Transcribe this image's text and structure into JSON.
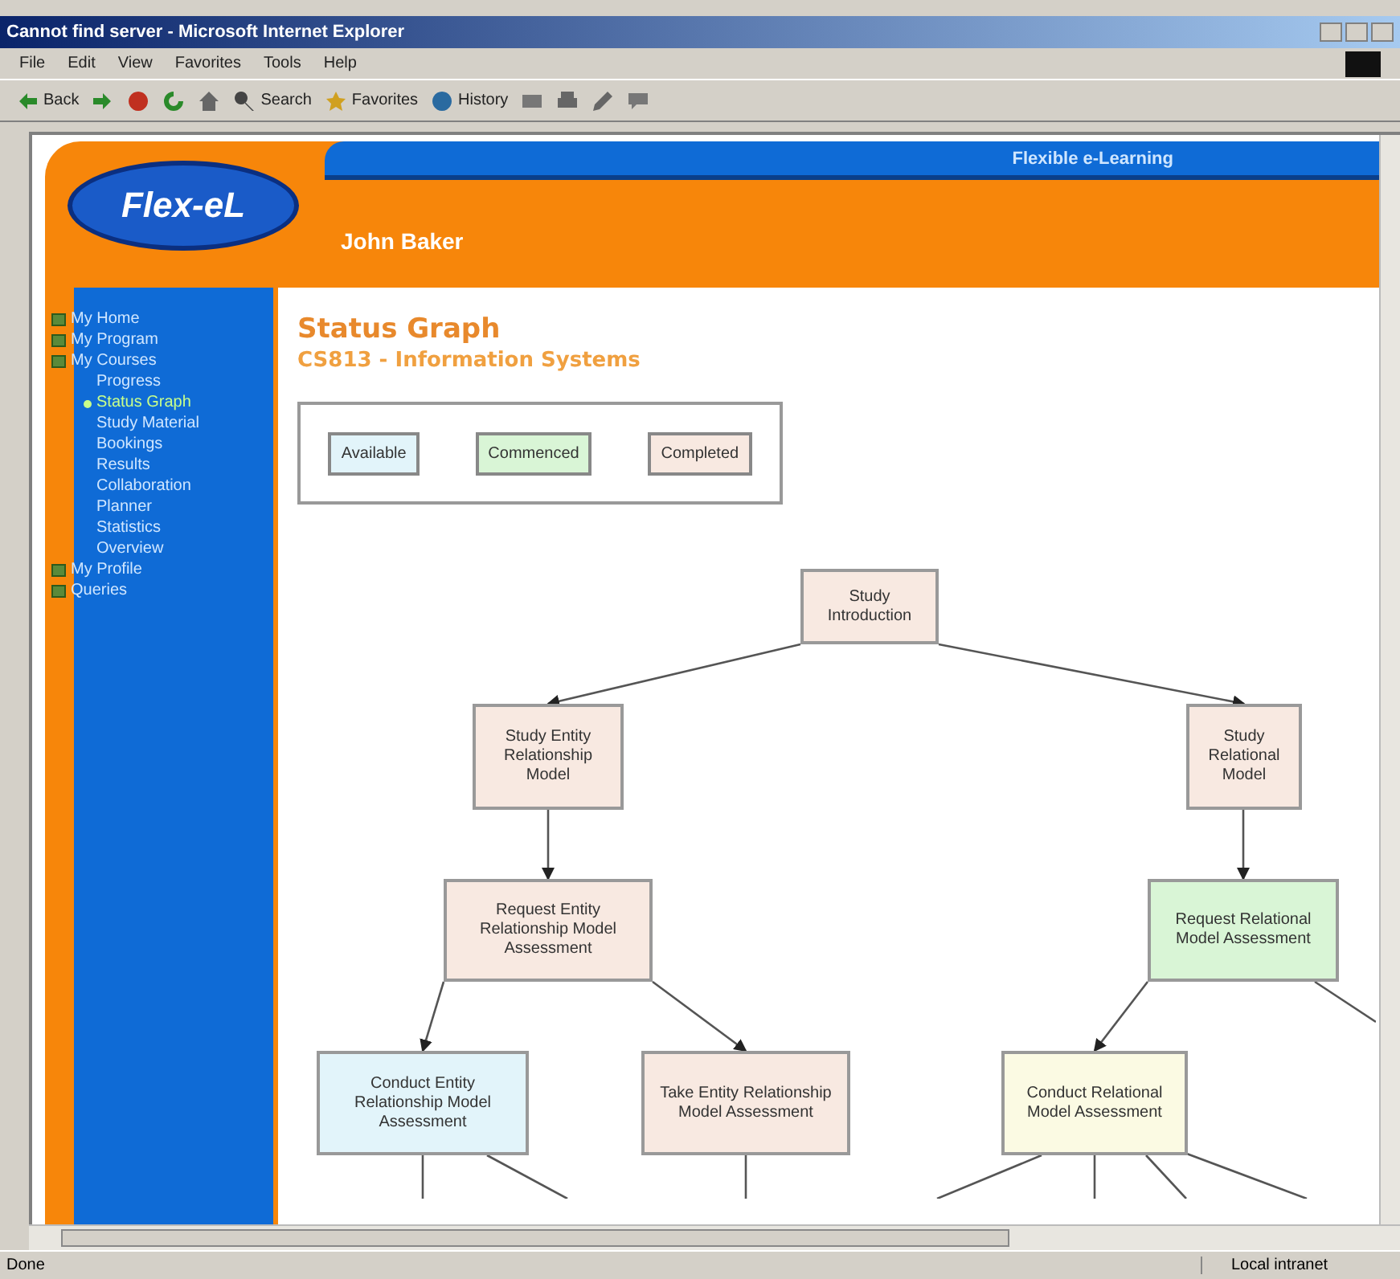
{
  "window": {
    "title": "Cannot find server - Microsoft Internet Explorer"
  },
  "menu": [
    "File",
    "Edit",
    "View",
    "Favorites",
    "Tools",
    "Help"
  ],
  "toolbar": [
    {
      "kind": "back",
      "label": "Back"
    },
    {
      "kind": "forward"
    },
    {
      "kind": "stop"
    },
    {
      "kind": "refresh"
    },
    {
      "kind": "home"
    },
    {
      "kind": "search",
      "label": "Search"
    },
    {
      "kind": "favorites",
      "label": "Favorites"
    },
    {
      "kind": "history",
      "label": "History"
    },
    {
      "kind": "mail"
    },
    {
      "kind": "print"
    },
    {
      "kind": "edit"
    },
    {
      "kind": "discuss"
    }
  ],
  "header": {
    "logo": "Flex-eL",
    "tagline": "Flexible e-Learning",
    "user": "John Baker"
  },
  "sidebar": {
    "items": [
      {
        "label": "My Home",
        "selected": false
      },
      {
        "label": "My Program",
        "selected": false
      },
      {
        "label": "My Courses",
        "selected": false,
        "children": [
          {
            "label": "Progress",
            "selected": false
          },
          {
            "label": "Status Graph",
            "selected": true
          },
          {
            "label": "Study Material",
            "selected": false
          },
          {
            "label": "Bookings",
            "selected": false
          },
          {
            "label": "Results",
            "selected": false
          },
          {
            "label": "Collaboration",
            "selected": false
          },
          {
            "label": "Planner",
            "selected": false
          },
          {
            "label": "Statistics",
            "selected": false
          },
          {
            "label": "Overview",
            "selected": false
          }
        ]
      },
      {
        "label": "My Profile",
        "selected": false
      },
      {
        "label": "Queries",
        "selected": false
      }
    ]
  },
  "main": {
    "title": "Status Graph",
    "subtitle": "CS813 - Information Systems",
    "legend": [
      {
        "label": "Available",
        "color": "#e2f4fa"
      },
      {
        "label": "Commenced",
        "color": "#d9f5d6"
      },
      {
        "label": "Completed",
        "color": "#f8e9e1"
      }
    ],
    "graph": {
      "nodes": [
        {
          "label": "Study Introduction",
          "color": "#f8e9e1",
          "children": [
            {
              "label": "Study Entity Relationship Model",
              "color": "#f8e9e1",
              "children": [
                {
                  "label": "Request Entity Relationship Model Assessment",
                  "color": "#f8e9e1",
                  "children": [
                    {
                      "label": "Conduct Entity Relationship Model Assessment",
                      "color": "#e2f4fa"
                    },
                    {
                      "label": "Take Entity Relationship Model Assessment",
                      "color": "#f8e9e1"
                    }
                  ]
                }
              ]
            },
            {
              "label": "Study Relational Model",
              "color": "#f8e9e1",
              "children": [
                {
                  "label": "Request Relational Model Assessment",
                  "color": "#d9f5d6",
                  "children": [
                    {
                      "label": "Conduct Relational Model Assessment",
                      "color": "#fbfae3"
                    }
                  ]
                }
              ]
            }
          ]
        }
      ]
    }
  },
  "status_bar": {
    "status": "Done",
    "zone": "Local intranet"
  }
}
